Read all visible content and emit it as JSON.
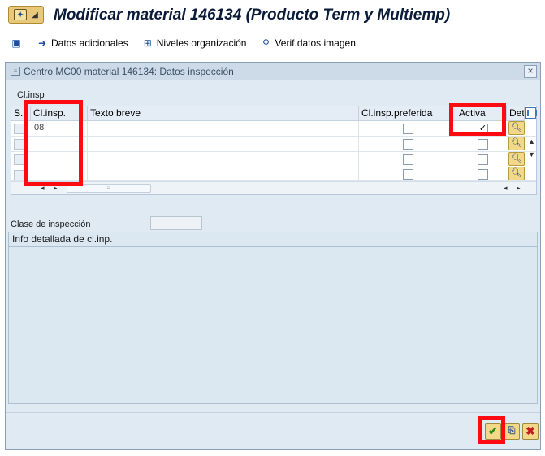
{
  "window": {
    "title": "Modificar material 146134 (Producto Term y Multiemp)"
  },
  "toolbar": {
    "items": [
      {
        "label": "Datos adicionales",
        "icon": "arrow-right-icon"
      },
      {
        "label": "Niveles organización",
        "icon": "org-levels-icon"
      },
      {
        "label": "Verif.datos imagen",
        "icon": "check-data-icon"
      }
    ]
  },
  "dialog": {
    "title": "Centro MC00 material 146134: Datos inspección",
    "group_label": "Cl.insp",
    "table": {
      "columns": {
        "sel": "S...",
        "cl_insp": "Cl.insp.",
        "texto_breve": "Texto breve",
        "preferida": "Cl.insp.preferida",
        "activa": "Activa",
        "det": "Det."
      },
      "rows": [
        {
          "cl_insp": "08",
          "texto_breve": "",
          "preferida": false,
          "activa": true
        },
        {
          "cl_insp": "",
          "texto_breve": "",
          "preferida": false,
          "activa": false
        },
        {
          "cl_insp": "",
          "texto_breve": "",
          "preferida": false,
          "activa": false
        },
        {
          "cl_insp": "",
          "texto_breve": "",
          "preferida": false,
          "activa": false
        }
      ]
    },
    "clase_label": "Clase de inspección",
    "clase_value": "",
    "info_title": "Info detallada de cl.inp."
  },
  "colors": {
    "highlight": "#ff0a10",
    "dialog_bg": "#dfeaf3"
  }
}
